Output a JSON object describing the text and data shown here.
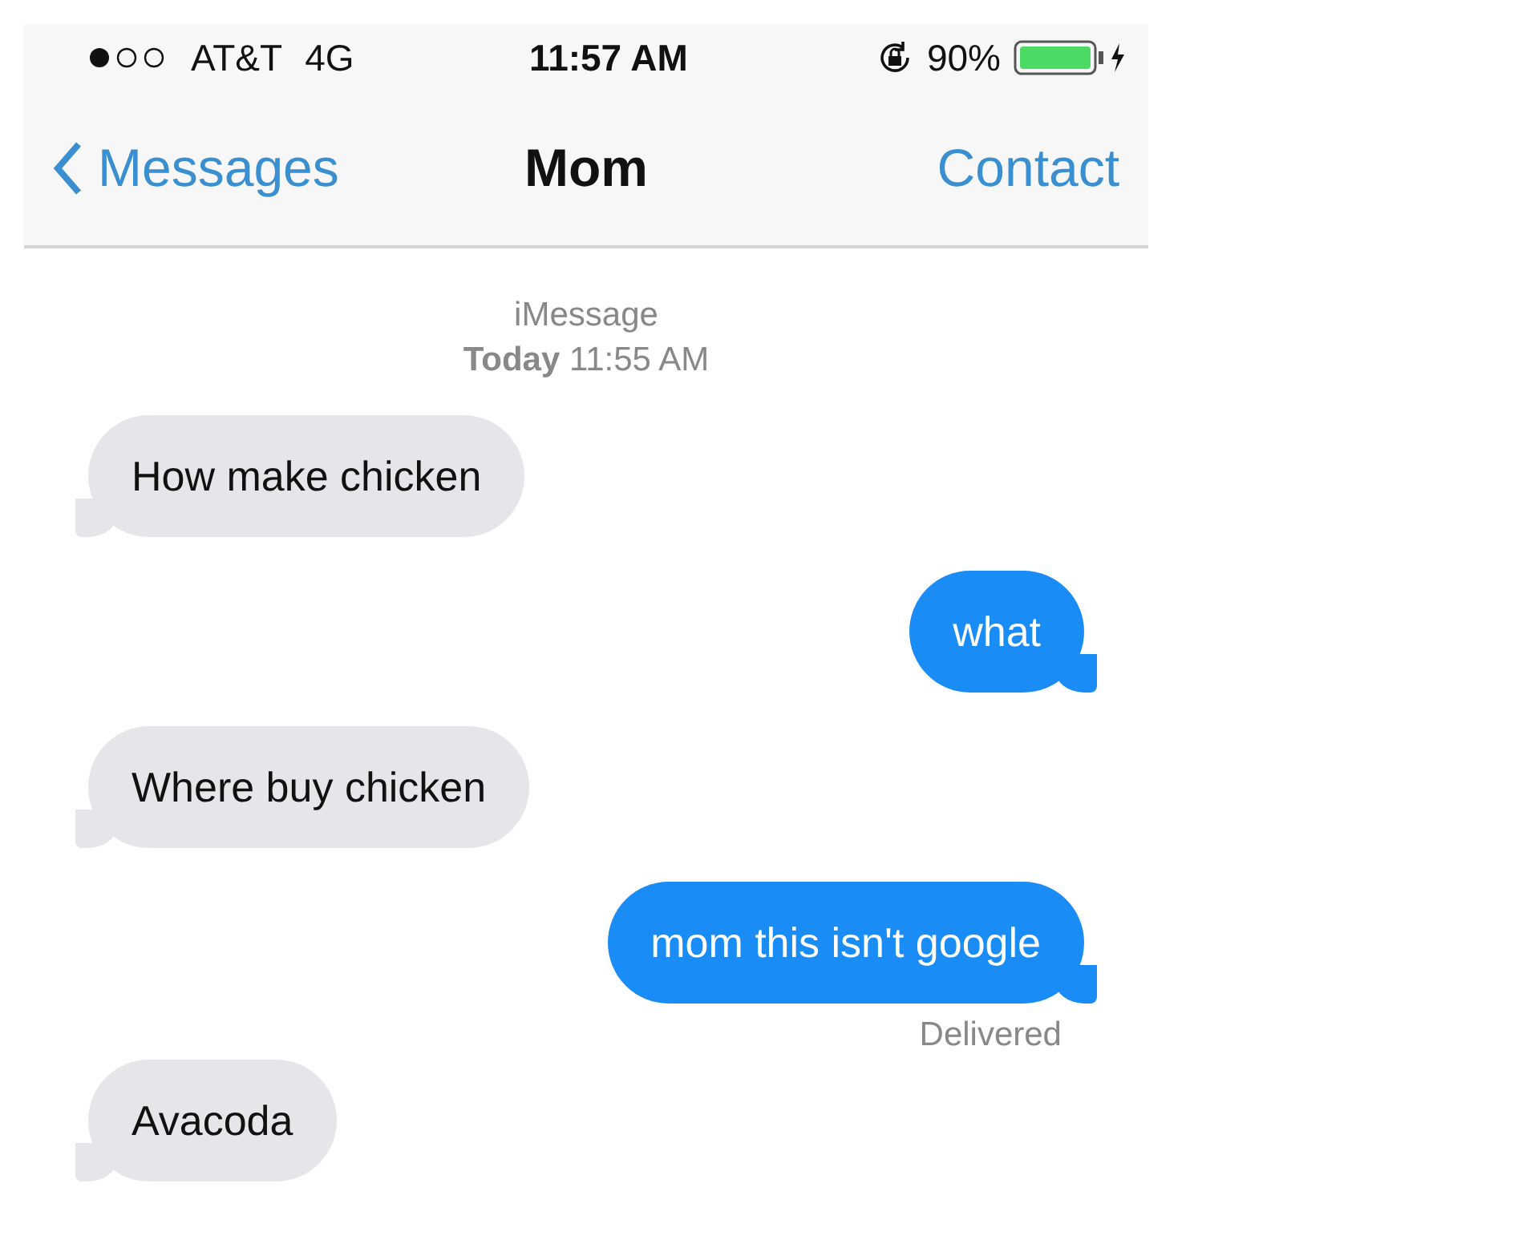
{
  "status_bar": {
    "carrier": "AT&T",
    "network": "4G",
    "time": "11:57 AM",
    "battery": "90%"
  },
  "nav": {
    "back": "Messages",
    "title": "Mom",
    "action": "Contact"
  },
  "conversation_header": {
    "service": "iMessage",
    "timestamp": "**Today** 11:55 AM"
  },
  "messages": [
    {
      "kind": "incoming",
      "text": "How make chicken"
    },
    {
      "kind": "outgoing",
      "text": "what"
    },
    {
      "kind": "incoming",
      "text": "Where buy chicken"
    },
    {
      "kind": "outgoing",
      "text": "mom this isn't google",
      "status": "Delivered"
    },
    {
      "kind": "incoming",
      "text": "Avacoda"
    }
  ]
}
